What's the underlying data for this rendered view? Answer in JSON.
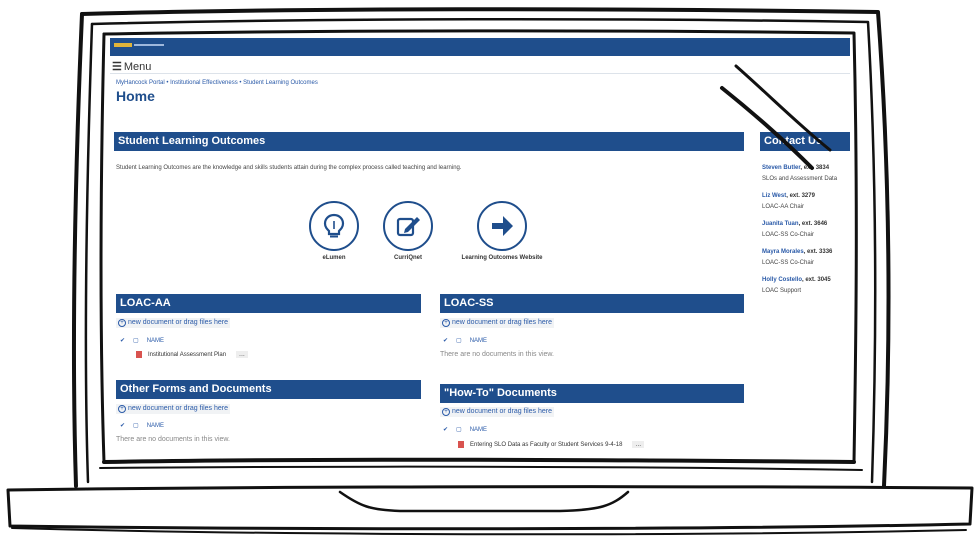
{
  "menu": {
    "label": "Menu",
    "icon": "hamburger-icon"
  },
  "breadcrumb": "MyHancock Portal  •  Institutional Effectiveness  •  Student Learning Outcomes",
  "page_title": "Home",
  "slo_section": {
    "title": "Student Learning Outcomes",
    "description": "Student Learning Outcomes are the knowledge and skills students attain during the complex process called teaching and learning."
  },
  "tiles": [
    {
      "label": "eLumen",
      "icon": "lightbulb-icon"
    },
    {
      "label": "CurriQnet",
      "icon": "edit-icon"
    },
    {
      "label": "Learning Outcomes Website",
      "icon": "arrow-right-icon"
    }
  ],
  "contact": {
    "title": "Contact Us",
    "people": [
      {
        "name": "Steven Butler",
        "ext": ", ext. 3834",
        "role": "SLOs and Assessment Data"
      },
      {
        "name": "Liz West",
        "ext": ", ext. 3279",
        "role": "LOAC-AA Chair"
      },
      {
        "name": "Juanita Tuan",
        "ext": ", ext. 3646",
        "role": "LOAC-SS Co-Chair"
      },
      {
        "name": "Mayra Morales",
        "ext": ", ext. 3336",
        "role": "LOAC-SS Co-Chair"
      },
      {
        "name": "Holly Costello",
        "ext": ", ext. 3045",
        "role": "LOAC Support"
      }
    ]
  },
  "libraries": {
    "new_doc": "new document or drag files here",
    "name_col": "NAME",
    "empty": "There are no documents in this view.",
    "loac_aa": {
      "title": "LOAC-AA",
      "docs": [
        "Institutional Assessment Plan"
      ]
    },
    "loac_ss": {
      "title": "LOAC-SS"
    },
    "other": {
      "title": "Other Forms and Documents"
    },
    "howto": {
      "title": "\"How-To\" Documents",
      "docs": [
        "Entering SLO Data as Faculty or Student Services 9-4-18"
      ]
    }
  },
  "ellipsis": "...",
  "colors": {
    "brand_blue": "#1f4e8c",
    "link_blue": "#2a5aa8"
  }
}
